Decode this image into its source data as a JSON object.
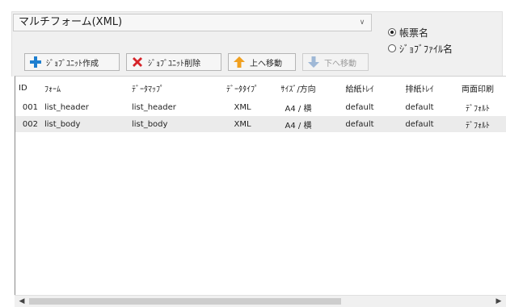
{
  "form_select": {
    "value": "マルチフォーム(XML)"
  },
  "radio_options": [
    {
      "label": "帳票名",
      "selected": true
    },
    {
      "label": "ｼﾞｮﾌﾞﾌｧｲﾙ名",
      "selected": false
    }
  ],
  "toolbar": {
    "create_label": "ｼﾞｮﾌﾞﾕﾆｯﾄ作成",
    "delete_label": "ｼﾞｮﾌﾞﾕﾆｯﾄ削除",
    "move_up_label": "上へ移動",
    "move_down_label": "下へ移動"
  },
  "table": {
    "headers": [
      "ID",
      "ﾌｫｰﾑ",
      "ﾃﾞｰﾀﾏｯﾌﾟ",
      "ﾃﾞｰﾀﾀｲﾌﾟ",
      "ｻｲｽﾞ/方向",
      "給紙ﾄﾚｲ",
      "排紙ﾄﾚｲ",
      "両面印刷"
    ],
    "rows": [
      [
        "001",
        "list_header",
        "list_header",
        "XML",
        "A4 / 横",
        "default",
        "default",
        "ﾃﾞﾌｫﾙﾄ"
      ],
      [
        "002",
        "list_body",
        "list_body",
        "XML",
        "A4 / 横",
        "default",
        "default",
        "ﾃﾞﾌｫﾙﾄ"
      ]
    ]
  },
  "colors": {
    "create_icon": "#1e7fd0",
    "delete_icon": "#d6242a",
    "move_up_icon": "#f0a020",
    "disabled_icon": "#9fb8d6"
  }
}
